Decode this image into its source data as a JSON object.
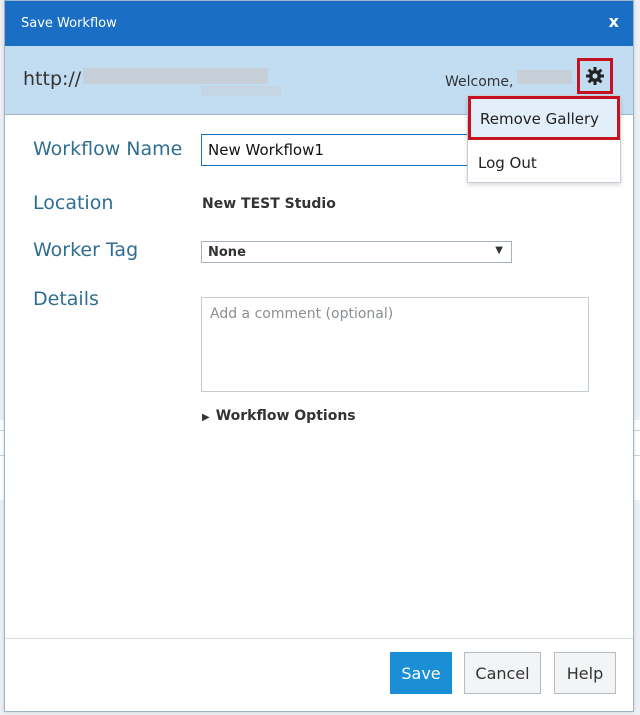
{
  "dialog": {
    "title": "Save Workflow",
    "close_label": "x"
  },
  "header": {
    "url_prefix": "http://",
    "welcome": "Welcome,"
  },
  "user_menu": {
    "items": [
      "Remove Gallery",
      "Log Out"
    ]
  },
  "form": {
    "workflow_name_label": "Workflow Name",
    "workflow_name_value": "New Workflow1",
    "location_label": "Location",
    "location_value": "New TEST Studio",
    "worker_tag_label": "Worker Tag",
    "worker_tag_value": "None",
    "details_label": "Details",
    "comment_placeholder": "Add a comment (optional)",
    "workflow_options": "Workflow Options"
  },
  "buttons": {
    "save": "Save",
    "cancel": "Cancel",
    "help": "Help"
  },
  "colors": {
    "titlebar": "#1a6fc4",
    "header_band": "#c2dcf2",
    "highlight_border": "#c41220",
    "label_text": "#2f6e94",
    "save_button": "#1a8fd6"
  },
  "icons": [
    "gear-icon",
    "close-icon",
    "chevron-down-icon",
    "triangle-right-icon"
  ]
}
